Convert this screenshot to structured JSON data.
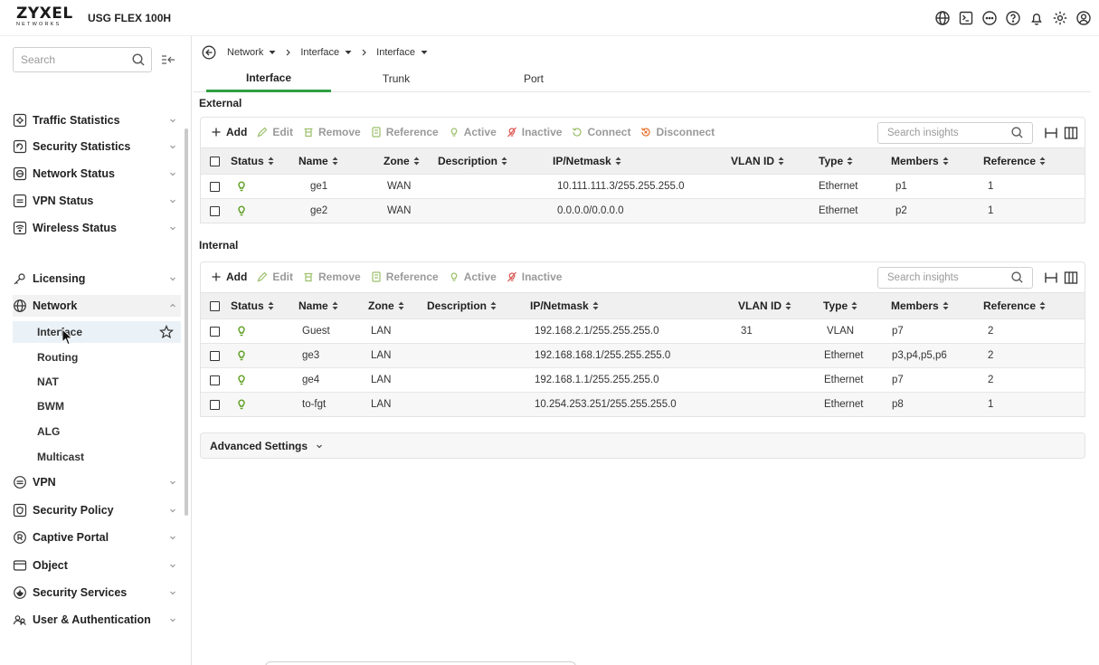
{
  "header": {
    "logo_main": "ZYXEL",
    "logo_sub": "NETWORKS",
    "device": "USG FLEX 100H",
    "icons": [
      "globe-icon",
      "cli-icon",
      "chat-icon",
      "help-icon",
      "bell-icon",
      "settings-icon",
      "user-icon"
    ]
  },
  "sidebar": {
    "search_placeholder": "Search",
    "items": [
      {
        "label": "Traffic Statistics",
        "icon": "traffic-icon"
      },
      {
        "label": "Security Statistics",
        "icon": "shield-chart-icon"
      },
      {
        "label": "Network Status",
        "icon": "network-status-icon"
      },
      {
        "label": "VPN Status",
        "icon": "vpn-status-icon"
      },
      {
        "label": "Wireless Status",
        "icon": "wifi-icon"
      },
      {
        "label": "Licensing",
        "icon": "key-icon"
      },
      {
        "label": "Network",
        "icon": "globe-icon"
      },
      {
        "label": "VPN",
        "icon": "vpn-icon"
      },
      {
        "label": "Security Policy",
        "icon": "policy-icon"
      },
      {
        "label": "Captive Portal",
        "icon": "portal-icon"
      },
      {
        "label": "Object",
        "icon": "object-icon"
      },
      {
        "label": "Security Services",
        "icon": "shield-icon"
      },
      {
        "label": "User & Authentication",
        "icon": "users-icon"
      }
    ],
    "network_sub": [
      "Interface",
      "Routing",
      "NAT",
      "BWM",
      "ALG",
      "Multicast"
    ]
  },
  "breadcrumb": [
    "Network",
    "Interface",
    "Interface"
  ],
  "tabs": [
    "Interface",
    "Trunk",
    "Port"
  ],
  "external": {
    "title": "External",
    "toolbar": {
      "add": "Add",
      "edit": "Edit",
      "remove": "Remove",
      "reference": "Reference",
      "active": "Active",
      "inactive": "Inactive",
      "connect": "Connect",
      "disconnect": "Disconnect",
      "search_placeholder": "Search insights"
    },
    "columns": [
      "Status",
      "Name",
      "Zone",
      "Description",
      "IP/Netmask",
      "VLAN ID",
      "Type",
      "Members",
      "Reference"
    ],
    "rows": [
      {
        "name": "ge1",
        "zone": "WAN",
        "description": "",
        "ip": "10.111.111.3/255.255.255.0",
        "vlan": "",
        "type": "Ethernet",
        "members": "p1",
        "reference": "1"
      },
      {
        "name": "ge2",
        "zone": "WAN",
        "description": "",
        "ip": "0.0.0.0/0.0.0.0",
        "vlan": "",
        "type": "Ethernet",
        "members": "p2",
        "reference": "1"
      }
    ]
  },
  "internal": {
    "title": "Internal",
    "toolbar": {
      "add": "Add",
      "edit": "Edit",
      "remove": "Remove",
      "reference": "Reference",
      "active": "Active",
      "inactive": "Inactive",
      "search_placeholder": "Search insights"
    },
    "columns": [
      "Status",
      "Name",
      "Zone",
      "Description",
      "IP/Netmask",
      "VLAN ID",
      "Type",
      "Members",
      "Reference"
    ],
    "rows": [
      {
        "name": "Guest",
        "zone": "LAN",
        "description": "",
        "ip": "192.168.2.1/255.255.255.0",
        "vlan": "31",
        "type": "VLAN",
        "members": "p7",
        "reference": "2"
      },
      {
        "name": "ge3",
        "zone": "LAN",
        "description": "",
        "ip": "192.168.168.1/255.255.255.0",
        "vlan": "",
        "type": "Ethernet",
        "members": "p3,p4,p5,p6",
        "reference": "2"
      },
      {
        "name": "ge4",
        "zone": "LAN",
        "description": "",
        "ip": "192.168.1.1/255.255.255.0",
        "vlan": "",
        "type": "Ethernet",
        "members": "p7",
        "reference": "2"
      },
      {
        "name": "to-fgt",
        "zone": "LAN",
        "description": "",
        "ip": "10.254.253.251/255.255.255.0",
        "vlan": "",
        "type": "Ethernet",
        "members": "p8",
        "reference": "1"
      }
    ]
  },
  "advanced": "Advanced Settings",
  "colors": {
    "accent": "#2ea043",
    "status_active": "#5c9e1f",
    "inactive_icon": "#d9534f",
    "disconnect_icon": "#e8702a"
  }
}
